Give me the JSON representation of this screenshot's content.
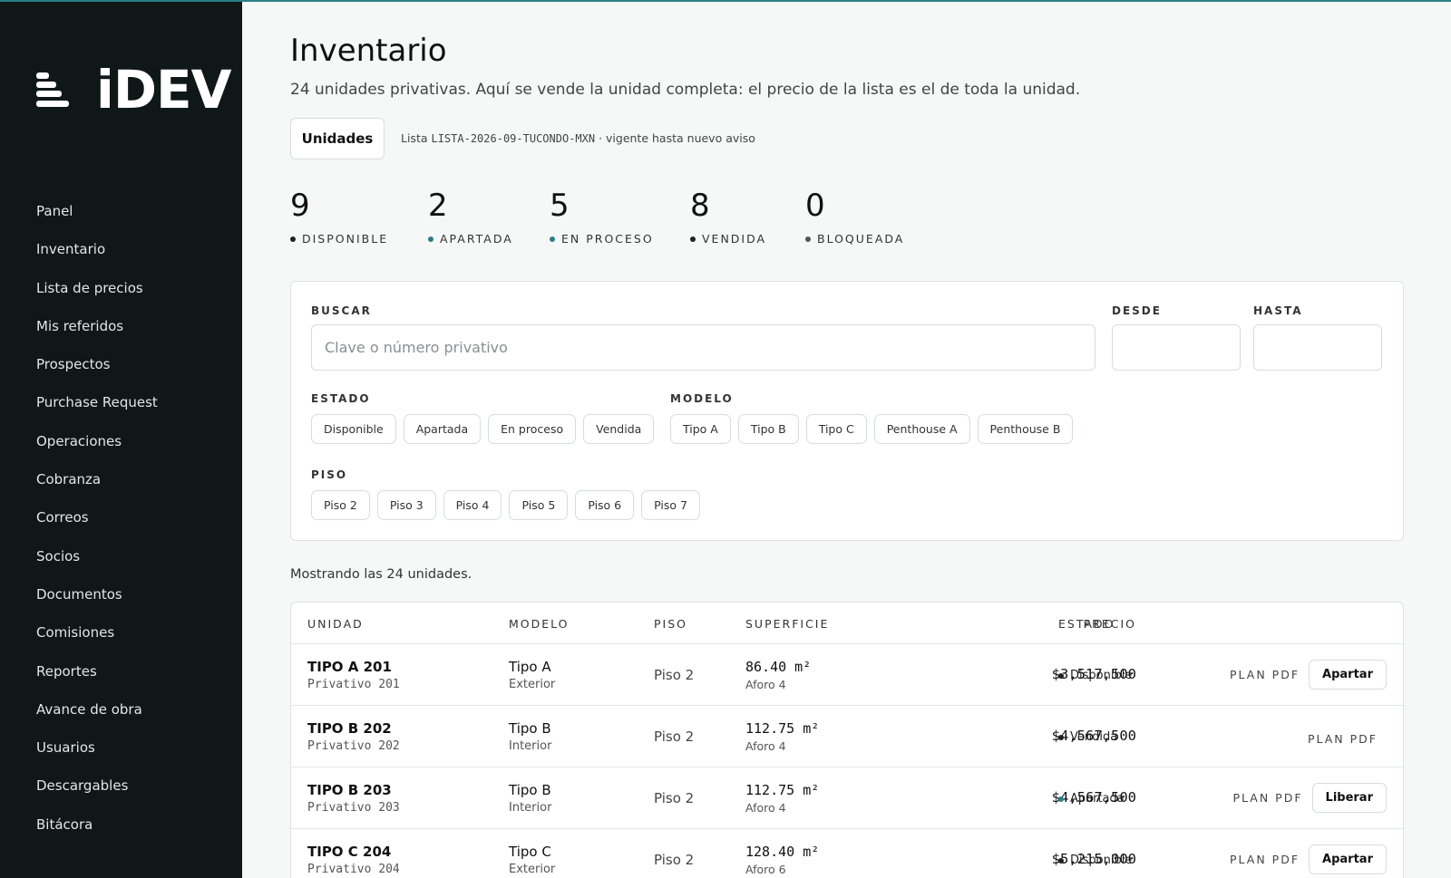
{
  "brand": {
    "name": "iDEV"
  },
  "sidebar": {
    "items": [
      {
        "label": "Panel"
      },
      {
        "label": "Inventario"
      },
      {
        "label": "Lista de precios"
      },
      {
        "label": "Mis referidos"
      },
      {
        "label": "Prospectos"
      },
      {
        "label": "Purchase Request"
      },
      {
        "label": "Operaciones"
      },
      {
        "label": "Cobranza"
      },
      {
        "label": "Correos"
      },
      {
        "label": "Socios"
      },
      {
        "label": "Documentos"
      },
      {
        "label": "Comisiones"
      },
      {
        "label": "Reportes"
      },
      {
        "label": "Avance de obra"
      },
      {
        "label": "Usuarios"
      },
      {
        "label": "Descargables"
      },
      {
        "label": "Bitácora"
      }
    ]
  },
  "header": {
    "title": "Inventario",
    "subtitle": "24 unidades privativas. Aquí se vende la unidad completa: el precio de la lista es el de toda la unidad.",
    "tab_label": "Unidades",
    "price_list_prefix": "Lista ",
    "price_list_code": "LISTA-2026-09-TUCONDO-MXN",
    "price_list_suffix": " · vigente hasta nuevo aviso"
  },
  "colors": {
    "accent": "#2a7f86",
    "dark": "#0f1719",
    "dot_dark": "#222222"
  },
  "stats": [
    {
      "value": "9",
      "label": "DISPONIBLE",
      "dot": "#222222"
    },
    {
      "value": "2",
      "label": "APARTADA",
      "dot": "#2a7f86"
    },
    {
      "value": "5",
      "label": "EN PROCESO",
      "dot": "#2a7f86"
    },
    {
      "value": "8",
      "label": "VENDIDA",
      "dot": "#222222"
    },
    {
      "value": "0",
      "label": "BLOQUEADA",
      "dot": "#555555"
    }
  ],
  "filters": {
    "search_label": "BUSCAR",
    "search_placeholder": "Clave o número privativo",
    "from_label": "DESDE",
    "to_label": "HASTA",
    "status_label": "ESTADO",
    "status_options": [
      "Disponible",
      "Apartada",
      "En proceso",
      "Vendida"
    ],
    "model_label": "MODELO",
    "model_options": [
      "Tipo A",
      "Tipo B",
      "Tipo C",
      "Penthouse A",
      "Penthouse B"
    ],
    "floor_label": "PISO",
    "floor_options": [
      "Piso 2",
      "Piso 3",
      "Piso 4",
      "Piso 5",
      "Piso 6",
      "Piso 7"
    ]
  },
  "showing": "Mostrando las 24 unidades.",
  "table": {
    "headers": {
      "unit": "UNIDAD",
      "model": "MODELO",
      "floor": "PISO",
      "surface": "SUPERFICIE",
      "price": "PRECIO",
      "status": "ESTADO"
    },
    "rows": [
      {
        "unit": "TIPO A 201",
        "sub": "Privativo 201",
        "model": "Tipo A",
        "model_sub": "Exterior",
        "floor": "Piso 2",
        "surface": "86.40 m²",
        "capacity": "Aforo 4",
        "price": "$3,517,500",
        "status": "Disponible",
        "dot": "#222222",
        "plan": "PLAN PDF",
        "action": "Apartar"
      },
      {
        "unit": "TIPO B 202",
        "sub": "Privativo 202",
        "model": "Tipo B",
        "model_sub": "Interior",
        "floor": "Piso 2",
        "surface": "112.75 m²",
        "capacity": "Aforo 4",
        "price": "$4,567,500",
        "status": "Vendida",
        "dot": "#222222",
        "plan": "PLAN PDF",
        "action": ""
      },
      {
        "unit": "TIPO B 203",
        "sub": "Privativo 203",
        "model": "Tipo B",
        "model_sub": "Interior",
        "floor": "Piso 2",
        "surface": "112.75 m²",
        "capacity": "Aforo 4",
        "price": "$4,567,500",
        "status": "Apartada",
        "dot": "#2a7f86",
        "plan": "PLAN PDF",
        "action": "Liberar"
      },
      {
        "unit": "TIPO C 204",
        "sub": "Privativo 204",
        "model": "Tipo C",
        "model_sub": "Exterior",
        "floor": "Piso 2",
        "surface": "128.40 m²",
        "capacity": "Aforo 6",
        "price": "$5,215,000",
        "status": "Disponible",
        "dot": "#222222",
        "plan": "PLAN PDF",
        "action": "Apartar"
      }
    ]
  }
}
